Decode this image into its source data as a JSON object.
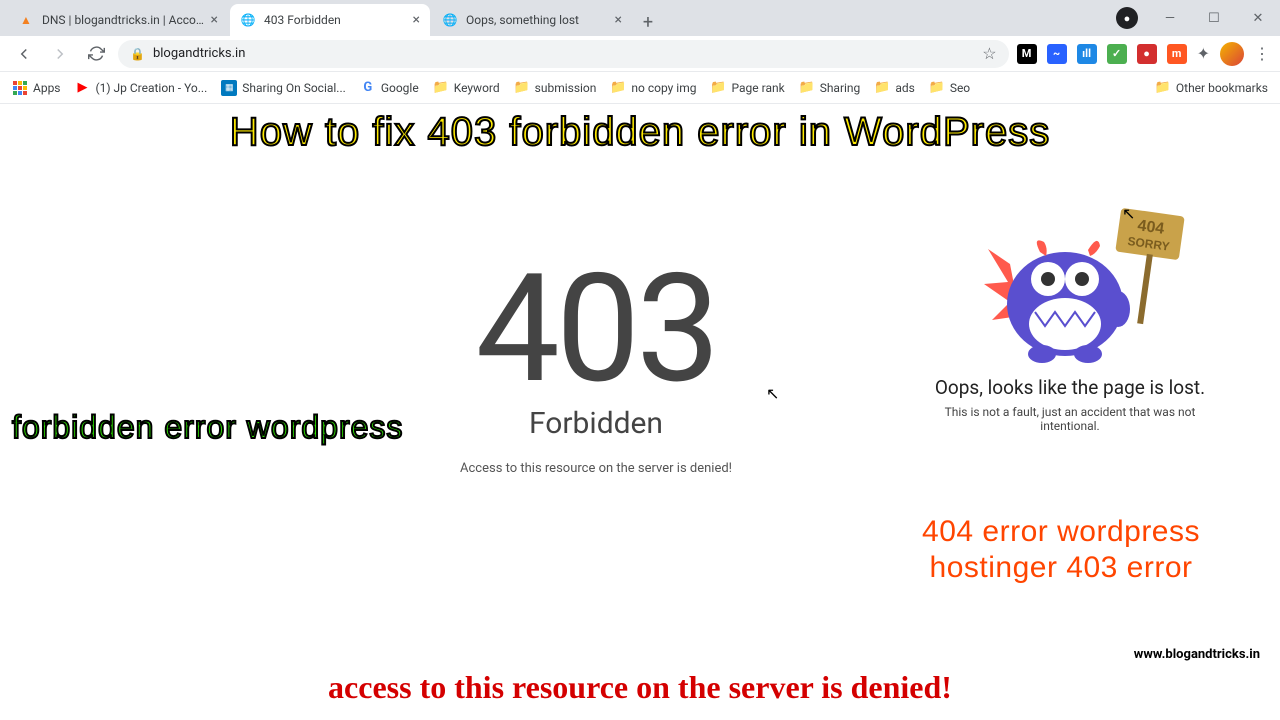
{
  "tabs": [
    {
      "title": "DNS | blogandtricks.in | Account",
      "favicon": "cloudflare"
    },
    {
      "title": "403 Forbidden",
      "favicon": "globe",
      "active": true
    },
    {
      "title": "Oops, something lost",
      "favicon": "globe"
    }
  ],
  "url": "blogandtricks.in",
  "bookmarks": {
    "apps": "Apps",
    "items": [
      {
        "label": "(1) Jp Creation - Yo...",
        "icon": "youtube"
      },
      {
        "label": "Sharing On Social...",
        "icon": "trello"
      },
      {
        "label": "Google",
        "icon": "google"
      },
      {
        "label": "Keyword",
        "icon": "folder"
      },
      {
        "label": "submission",
        "icon": "folder"
      },
      {
        "label": "no copy img",
        "icon": "folder"
      },
      {
        "label": "Page rank",
        "icon": "folder"
      },
      {
        "label": "Sharing",
        "icon": "folder"
      },
      {
        "label": "ads",
        "icon": "folder"
      },
      {
        "label": "Seo",
        "icon": "folder"
      }
    ],
    "other": "Other bookmarks"
  },
  "overlay": {
    "headline": "How to fix 403 forbidden error in WordPress",
    "green": "forbidden error wordpress",
    "orange_line1": "404 error wordpress",
    "orange_line2": "hostinger 403 error",
    "bottom": "access to this resource on the server is denied!",
    "watermark": "www.blogandtricks.in"
  },
  "error403": {
    "code": "403",
    "label": "Forbidden",
    "message": "Access to this resource on the server is denied!"
  },
  "error404": {
    "sign_line1": "404",
    "sign_line2": "SORRY",
    "title": "Oops, looks like the page is lost.",
    "subtitle": "This is not a fault, just an accident that was not intentional."
  }
}
